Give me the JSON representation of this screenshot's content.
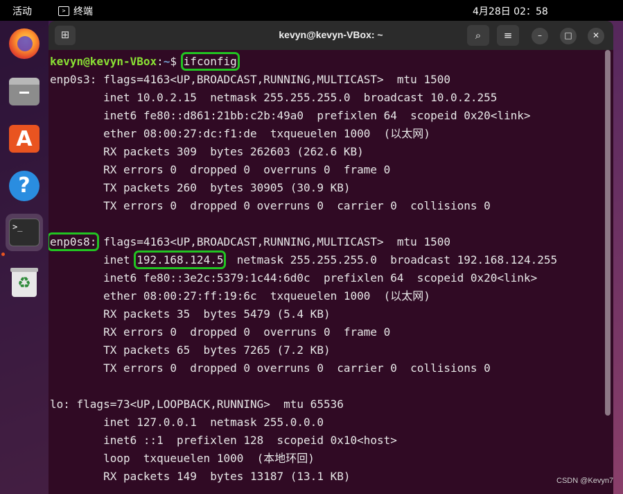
{
  "topbar": {
    "activities": "活动",
    "app_name": "终端",
    "clock": "4月28日  02：58"
  },
  "dock": {
    "items": [
      {
        "name": "firefox",
        "icon": "firefox-icon"
      },
      {
        "name": "files",
        "icon": "files-icon"
      },
      {
        "name": "app-center",
        "icon": "store-icon"
      },
      {
        "name": "help",
        "icon": "help-icon"
      },
      {
        "name": "terminal",
        "icon": "terminal-icon",
        "active": true
      },
      {
        "name": "trash",
        "icon": "trash-icon"
      }
    ],
    "help_glyph": "?",
    "store_glyph": "A",
    "terminal_glyph": ">_"
  },
  "window": {
    "title": "kevyn@kevyn-VBox: ~",
    "new_tab_glyph": "⊞",
    "search_glyph": "⌕",
    "menu_glyph": "≡",
    "minimize_glyph": "–",
    "maximize_glyph": "□",
    "close_glyph": "✕"
  },
  "terminal": {
    "prompt_user": "kevyn@kevyn-VBox",
    "prompt_sep": ":",
    "prompt_path": "~",
    "prompt_dollar": "$ ",
    "command": "ifconfig",
    "if1_name": "enp0s3:",
    "if1_flags": " flags=4163<UP,BROADCAST,RUNNING,MULTICAST>  mtu 1500",
    "if1_lines": [
      "        inet 10.0.2.15  netmask 255.255.255.0  broadcast 10.0.2.255",
      "        inet6 fe80::d861:21bb:c2b:49a0  prefixlen 64  scopeid 0x20<link>",
      "        ether 08:00:27:dc:f1:de  txqueuelen 1000  (以太网)",
      "        RX packets 309  bytes 262603 (262.6 KB)",
      "        RX errors 0  dropped 0  overruns 0  frame 0",
      "        TX packets 260  bytes 30905 (30.9 KB)",
      "        TX errors 0  dropped 0 overruns 0  carrier 0  collisions 0"
    ],
    "if2_name": "enp0s8:",
    "if2_flags": " flags=4163<UP,BROADCAST,RUNNING,MULTICAST>  mtu 1500",
    "if2_inet_prefix": "        inet ",
    "if2_inet_addr": "192.168.124.5",
    "if2_inet_suffix": "  netmask 255.255.255.0  broadcast 192.168.124.255",
    "if2_lines": [
      "        inet6 fe80::3e2c:5379:1c44:6d0c  prefixlen 64  scopeid 0x20<link>",
      "        ether 08:00:27:ff:19:6c  txqueuelen 1000  (以太网)",
      "        RX packets 35  bytes 5479 (5.4 KB)",
      "        RX errors 0  dropped 0  overruns 0  frame 0",
      "        TX packets 65  bytes 7265 (7.2 KB)",
      "        TX errors 0  dropped 0 overruns 0  carrier 0  collisions 0"
    ],
    "lo_lines": [
      "lo: flags=73<UP,LOOPBACK,RUNNING>  mtu 65536",
      "        inet 127.0.0.1  netmask 255.0.0.0",
      "        inet6 ::1  prefixlen 128  scopeid 0x10<host>",
      "        loop  txqueuelen 1000  (本地环回)",
      "        RX packets 149  bytes 13187 (13.1 KB)"
    ]
  },
  "watermark": "CSDN @Kevyn7",
  "colors": {
    "terminal_bg": "#300a24",
    "prompt_user": "#8ae234",
    "prompt_path": "#729fcf",
    "highlight_box": "#22c422",
    "accent": "#e95420"
  }
}
